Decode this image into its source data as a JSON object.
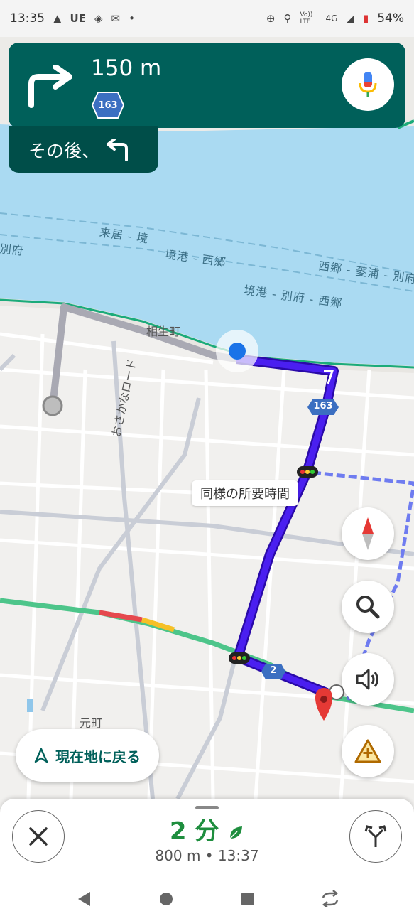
{
  "status_bar": {
    "time": "13:35",
    "carrier_icon_text": "UE",
    "network_label": "Vo)) LTE",
    "signal_label": "4G",
    "battery": "54%"
  },
  "map": {
    "water_labels": [
      "来居 - 境",
      "境港 - 西郷",
      "西郷 - 菱浦 - 別府",
      "境港 - 別府 - 西郷",
      "別府"
    ],
    "street_labels": [
      "相生町",
      "おさかなロード",
      "元町"
    ],
    "road_shields": [
      "163",
      "2"
    ],
    "similar_time_label": "同様の所要時間"
  },
  "nav_card": {
    "distance": "150 m",
    "road_number": "163",
    "then_label": "その後、"
  },
  "buttons": {
    "recenter_label": "現在地に戻る"
  },
  "bottom_sheet": {
    "eta": "2 分",
    "summary": "800 m  •  13:37"
  },
  "icons": {
    "turn": "turn-right-icon",
    "then_turn": "turn-left-icon",
    "mic": "mic-icon",
    "compass": "compass-icon",
    "search": "search-icon",
    "sound": "volume-icon",
    "report": "report-incident-icon",
    "close": "close-icon",
    "alternate_routes": "alternate-routes-icon",
    "eco": "leaf-icon"
  },
  "colors": {
    "nav_green": "#00605a",
    "route_blue": "#3a12d6",
    "eta_green": "#1e8e3e",
    "water": "#aadaf2"
  }
}
